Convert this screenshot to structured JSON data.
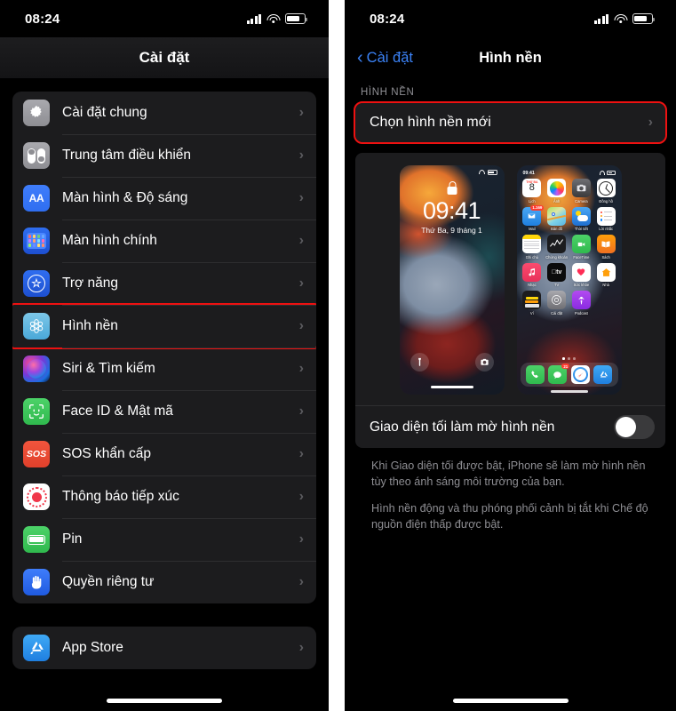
{
  "left": {
    "status": {
      "time": "08:24"
    },
    "nav": {
      "title": "Cài đặt"
    },
    "groups": [
      {
        "items": [
          {
            "label": "Cài đặt chung",
            "icon": "gear-icon"
          },
          {
            "label": "Trung tâm điều khiển",
            "icon": "control-center-icon"
          },
          {
            "label": "Màn hình & Độ sáng",
            "icon": "display-brightness-icon"
          },
          {
            "label": "Màn hình chính",
            "icon": "home-screen-icon"
          },
          {
            "label": "Trợ năng",
            "icon": "accessibility-icon"
          },
          {
            "label": "Hình nền",
            "icon": "wallpaper-icon",
            "highlighted": true
          },
          {
            "label": "Siri & Tìm kiếm",
            "icon": "siri-icon"
          },
          {
            "label": "Face ID & Mật mã",
            "icon": "face-id-icon"
          },
          {
            "label": "SOS khẩn cấp",
            "icon": "sos-icon"
          },
          {
            "label": "Thông báo tiếp xúc",
            "icon": "exposure-notification-icon"
          },
          {
            "label": "Pin",
            "icon": "battery-icon"
          },
          {
            "label": "Quyền riêng tư",
            "icon": "privacy-hand-icon"
          }
        ]
      },
      {
        "items": [
          {
            "label": "App Store",
            "icon": "app-store-icon"
          }
        ]
      }
    ]
  },
  "right": {
    "status": {
      "time": "08:24"
    },
    "nav": {
      "back_label": "Cài đặt",
      "title": "Hình nền"
    },
    "section_header": "HÌNH NỀN",
    "choose_row": {
      "label": "Chọn hình nền mới",
      "highlighted": true
    },
    "lock_preview": {
      "time": "09:41",
      "date": "Thứ Ba, 9 tháng 1"
    },
    "home_preview": {
      "status_time": "09:41",
      "apps": [
        {
          "name": "Lịch",
          "icon": "calendar-icon",
          "day": "8",
          "weekday": "THỨ BA"
        },
        {
          "name": "Ảnh",
          "icon": "photos-icon"
        },
        {
          "name": "Camera",
          "icon": "camera-icon"
        },
        {
          "name": "Đồng hồ",
          "icon": "clock-icon"
        },
        {
          "name": "Mail",
          "icon": "mail-icon",
          "badge": "1.169"
        },
        {
          "name": "Bản đồ",
          "icon": "maps-icon"
        },
        {
          "name": "Thời tiết",
          "icon": "weather-icon"
        },
        {
          "name": "Lời nhắc",
          "icon": "reminders-icon"
        },
        {
          "name": "Ghi chú",
          "icon": "notes-icon"
        },
        {
          "name": "Chứng khoán",
          "icon": "stocks-icon"
        },
        {
          "name": "FaceTime",
          "icon": "facetime-icon"
        },
        {
          "name": "Sách",
          "icon": "books-icon"
        },
        {
          "name": "Nhạc",
          "icon": "music-icon"
        },
        {
          "name": "TV",
          "icon": "tv-icon"
        },
        {
          "name": "Sức khỏe",
          "icon": "health-icon"
        },
        {
          "name": "Nhà",
          "icon": "home-app-icon"
        },
        {
          "name": "Ví",
          "icon": "wallet-icon"
        },
        {
          "name": "Cài đặt",
          "icon": "settings-app-icon"
        },
        {
          "name": "Podcast",
          "icon": "podcasts-icon"
        }
      ],
      "dock": [
        {
          "name": "Điện thoại",
          "icon": "phone-icon"
        },
        {
          "name": "Tin nhắn",
          "icon": "messages-icon",
          "badge": "21"
        },
        {
          "name": "Safari",
          "icon": "safari-icon"
        },
        {
          "name": "App Store",
          "icon": "app-store-icon"
        }
      ],
      "page_dots": 3,
      "active_dot": 0
    },
    "toggle": {
      "label": "Giao diện tối làm mờ hình nền",
      "on": false
    },
    "footnotes": [
      "Khi Giao diện tối được bật, iPhone sẽ làm mờ hình nền tùy theo ánh sáng môi trường của bạn.",
      "Hình nền động và thu phóng phối cảnh bị tắt khi Chế độ nguồn điện thấp được bật."
    ]
  },
  "colors": {
    "highlight": "#ee1111",
    "accent_blue": "#3b82f6",
    "card": "#1c1c1e",
    "secondary_text": "#8e8e93"
  }
}
